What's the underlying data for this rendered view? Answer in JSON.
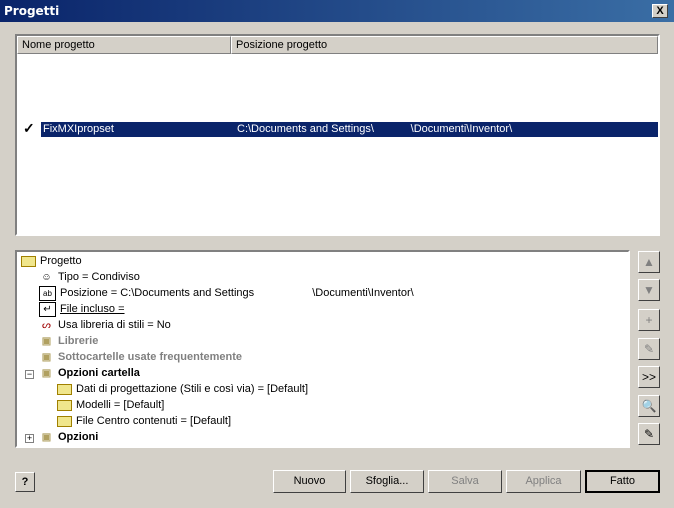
{
  "window": {
    "title": "Progetti",
    "close_label": "X"
  },
  "list": {
    "columns": [
      "Nome progetto",
      "Posizione progetto"
    ],
    "rows": [
      {
        "name": "FixMXIpropset",
        "path": "C:\\Documents and Settings\\            \\Documenti\\Inventor\\"
      }
    ]
  },
  "tree": {
    "root": "Progetto",
    "items": [
      {
        "icon": "type-icon",
        "label": "Tipo = Condiviso"
      },
      {
        "icon": "ab-icon",
        "label": "Posizione = C:\\Documents and Settings                   \\Documenti\\Inventor\\"
      },
      {
        "icon": "file-icon",
        "label": "File incluso ="
      },
      {
        "icon": "style-icon",
        "label": "Usa libreria di stili = No"
      },
      {
        "icon": "library-icon",
        "label": "Librerie"
      },
      {
        "icon": "library-icon",
        "label": "Sottocartelle usate frequentemente"
      },
      {
        "icon": "folder-icon",
        "label": "Opzioni cartella"
      },
      {
        "icon": "folder-icon",
        "label": "Dati di progettazione (Stili e così via) = [Default]"
      },
      {
        "icon": "folder-icon",
        "label": "Modelli = [Default]"
      },
      {
        "icon": "folder-icon",
        "label": "File Centro contenuti = [Default]"
      },
      {
        "icon": "library-icon",
        "label": "Opzioni"
      }
    ]
  },
  "side_buttons": [
    "▲",
    "▼",
    "+",
    "✎",
    ">>",
    "🔍",
    "✎"
  ],
  "buttons": {
    "help": "?",
    "new": "Nuovo",
    "browse": "Sfoglia...",
    "save": "Salva",
    "apply": "Applica",
    "done": "Fatto"
  }
}
